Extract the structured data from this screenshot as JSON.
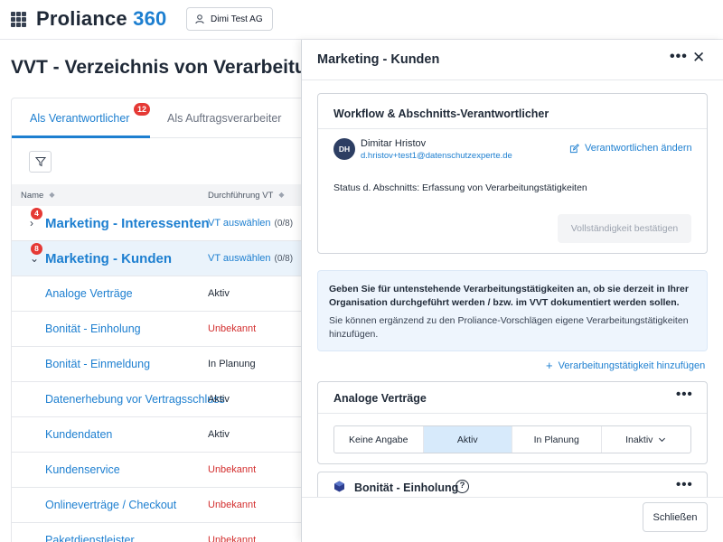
{
  "header": {
    "brand_name": "Proliance",
    "brand_number": "360",
    "tenant": "Dimi Test AG"
  },
  "page": {
    "title": "VVT - Verzeichnis von Verarbeitungstätigkeiten"
  },
  "tabs": [
    {
      "label": "Als Verantwortlicher",
      "badge": "12",
      "active": true
    },
    {
      "label": "Als Auftragsverarbeiter",
      "active": false
    }
  ],
  "table": {
    "col_name": "Name",
    "col_status": "Durchführung VT",
    "groups": [
      {
        "name": "Marketing - Interessenten",
        "badge": "4",
        "action": "VT auswählen",
        "count": "(0/8)",
        "chevron": "›"
      },
      {
        "name": "Marketing - Kunden",
        "badge": "8",
        "action": "VT auswählen",
        "count": "(0/8)",
        "chevron": "⌄"
      }
    ],
    "rows": [
      {
        "name": "Analoge Verträge",
        "status": "Aktiv"
      },
      {
        "name": "Bonität - Einholung",
        "status": "Unbekannt"
      },
      {
        "name": "Bonität - Einmeldung",
        "status": "In Planung"
      },
      {
        "name": "Datenerhebung vor Vertragsschluss",
        "status": "Aktiv"
      },
      {
        "name": "Kundendaten",
        "status": "Aktiv"
      },
      {
        "name": "Kundenservice",
        "status": "Unbekannt"
      },
      {
        "name": "Onlineverträge / Checkout",
        "status": "Unbekannt"
      },
      {
        "name": "Paketdienstleister",
        "status": "Unbekannt"
      }
    ]
  },
  "panel": {
    "title": "Marketing - Kunden",
    "more": "•••",
    "close": "✕",
    "workflow": {
      "title": "Workflow & Abschnitts-Verantwortlicher",
      "avatar": "DH",
      "person_name": "Dimitar Hristov",
      "person_email": "d.hristov+test1@datenschutzexperte.de",
      "change_label": "Verantwortlichen ändern",
      "status": "Status d. Abschnitts: Erfassung von Verarbeitungstätigkeiten",
      "confirm_label": "Vollständigkeit bestätigen"
    },
    "info": {
      "p1": "Geben Sie für untenstehende Verarbeitungstätigkeiten an, ob sie derzeit in Ihrer Organisation durchgeführt werden / bzw. im VVT dokumentiert werden sollen.",
      "p2": "Sie können ergänzend zu den Proliance-Vorschlägen eigene Verarbeitungstätigkeiten hinzufügen."
    },
    "add_label": "Verarbeitungstätigkeit hinzufügen",
    "activities": [
      {
        "title": "Analoge Verträge",
        "options": [
          "Keine Angabe",
          "Aktiv",
          "In Planung",
          "Inaktiv"
        ],
        "selected": "Aktiv"
      },
      {
        "title": "Bonität - Einholung",
        "help": "?"
      }
    ],
    "close_button": "Schließen"
  }
}
